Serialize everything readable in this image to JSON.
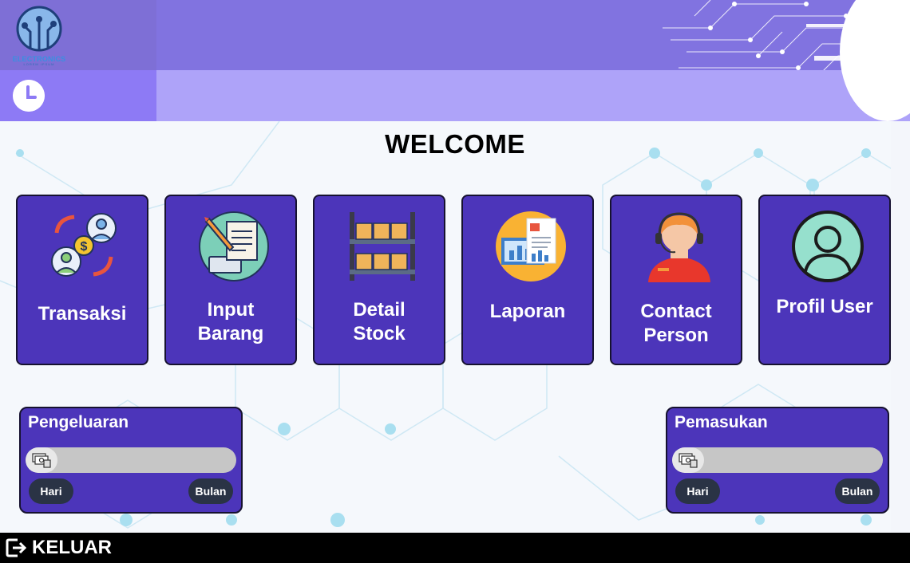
{
  "brand": {
    "name": "ELECTRONICS",
    "tagline": "LOREM IPSUM"
  },
  "welcome": "WELCOME",
  "menu": [
    {
      "label": "Transaksi",
      "icon": "transaction-icon"
    },
    {
      "label": "Input\nBarang",
      "icon": "input-document-icon"
    },
    {
      "label": "Detail\nStock",
      "icon": "warehouse-shelf-icon"
    },
    {
      "label": "Laporan",
      "icon": "report-icon"
    },
    {
      "label": "Contact\nPerson",
      "icon": "customer-service-icon"
    },
    {
      "label": "Profil User",
      "icon": "user-profile-icon"
    }
  ],
  "expenses": {
    "title": "Pengeluaran",
    "left_button": "Hari",
    "right_button": "Bulan",
    "progress": 0.15
  },
  "income": {
    "title": "Pemasukan",
    "left_button": "Hari",
    "right_button": "Bulan",
    "progress": 0.15
  },
  "footer": {
    "logout_label": "KELUAR"
  },
  "colors": {
    "card": "#4c35ba",
    "header_dark": "#8173e0",
    "header_light": "#aea3f9",
    "pill": "#2a3345"
  }
}
